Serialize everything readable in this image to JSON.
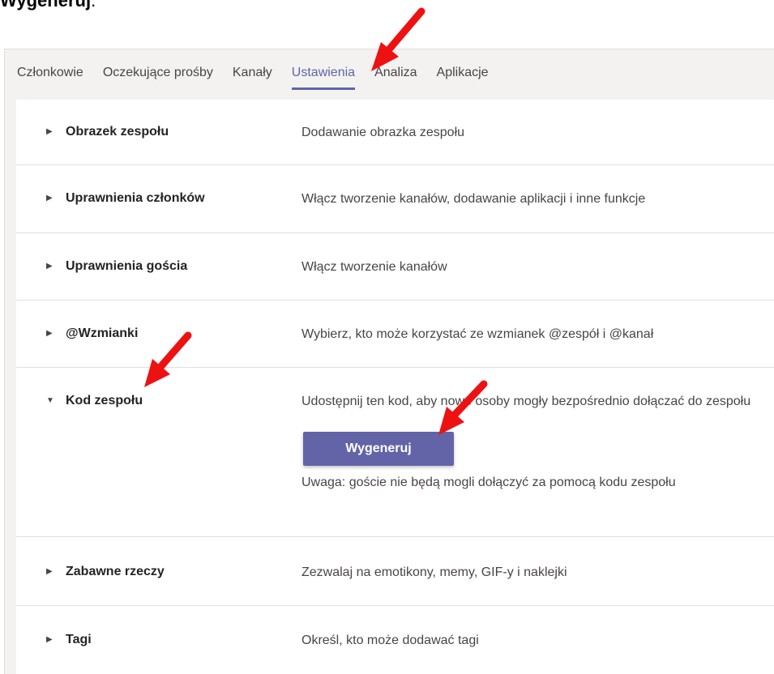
{
  "caption": {
    "text": "Wygeneruj",
    "suffix": "."
  },
  "tabs": [
    {
      "label": "Członkowie",
      "active": false
    },
    {
      "label": "Oczekujące prośby",
      "active": false
    },
    {
      "label": "Kanały",
      "active": false
    },
    {
      "label": "Ustawienia",
      "active": true
    },
    {
      "label": "Analiza",
      "active": false
    },
    {
      "label": "Aplikacje",
      "active": false
    }
  ],
  "settings": [
    {
      "title": "Obrazek zespołu",
      "description": "Dodawanie obrazka zespołu",
      "expanded": false
    },
    {
      "title": "Uprawnienia członków",
      "description": "Włącz tworzenie kanałów, dodawanie aplikacji i inne funkcje",
      "expanded": false
    },
    {
      "title": "Uprawnienia gościa",
      "description": "Włącz tworzenie kanałów",
      "expanded": false
    },
    {
      "title": "@Wzmianki",
      "description": "Wybierz, kto może korzystać ze wzmianek @zespół i @kanał",
      "expanded": false
    },
    {
      "title": "Kod zespołu",
      "description": "Udostępnij ten kod, aby nowe osoby mogły bezpośrednio dołączać do zespołu",
      "expanded": true,
      "button_label": "Wygeneruj",
      "note": "Uwaga: goście nie będą mogli dołączyć za pomocą kodu zespołu"
    },
    {
      "title": "Zabawne rzeczy",
      "description": "Zezwalaj na emotikony, memy, GIF-y i naklejki",
      "expanded": false
    },
    {
      "title": "Tagi",
      "description": "Określ, kto może dodawać tagi",
      "expanded": false
    }
  ],
  "icons": {
    "collapsed": "chevron-right-icon",
    "expanded": "chevron-down-icon",
    "annotation": "red-arrow-icon"
  },
  "colors": {
    "accent": "#6264a7",
    "arrow": "#ee1111",
    "app_background": "#f3f2f1",
    "panel": "#ffffff",
    "divider": "#e1dfdd"
  }
}
